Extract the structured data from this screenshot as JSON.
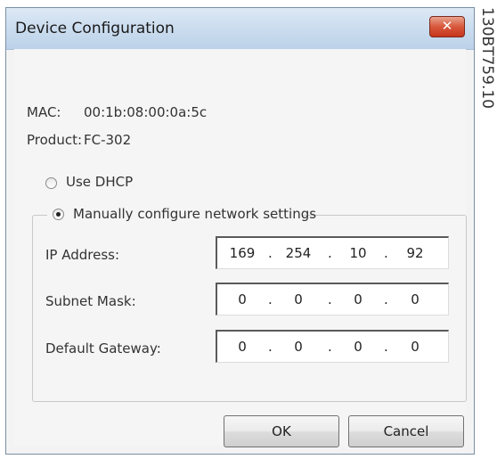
{
  "window": {
    "title": "Device Configuration",
    "close_glyph": "✕"
  },
  "info": {
    "mac_label": "MAC:",
    "mac_value": "00:1b:08:00:0a:5c",
    "product_label": "Product:",
    "product_value": "FC-302"
  },
  "options": {
    "dhcp_label": "Use DHCP",
    "dhcp_selected": false,
    "manual_label": "Manually configure network settings",
    "manual_selected": true
  },
  "fields": {
    "ip": {
      "label": "IP Address:",
      "octets": [
        "169",
        "254",
        "10",
        "92"
      ]
    },
    "subnet": {
      "label": "Subnet Mask:",
      "octets": [
        "0",
        "0",
        "0",
        "0"
      ]
    },
    "gateway": {
      "label": "Default Gateway:",
      "octets": [
        "0",
        "0",
        "0",
        "0"
      ]
    },
    "separator": "."
  },
  "buttons": {
    "ok_label": "OK",
    "cancel_label": "Cancel"
  },
  "watermark": "130BT759.10"
}
